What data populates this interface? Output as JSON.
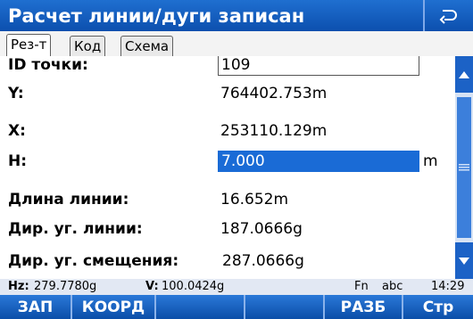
{
  "window": {
    "title": "Расчет линии/дуги записан"
  },
  "tabs": [
    {
      "label": "Рез-т",
      "active": true
    },
    {
      "label": "Код",
      "active": false
    },
    {
      "label": "Схема",
      "active": false
    }
  ],
  "fields": {
    "point_id": {
      "label": "ID точки:",
      "value": "109"
    },
    "y": {
      "label": "Y:",
      "value": "764402.753m"
    },
    "x": {
      "label": "X:",
      "value": "253110.129m"
    },
    "h": {
      "label": "H:",
      "value": "7.000",
      "unit": "m"
    },
    "line_length": {
      "label": "Длина линии:",
      "value": "16.652m"
    },
    "line_bearing": {
      "label": "Дир. уг. линии:",
      "value": "187.0666g"
    },
    "offset_bearing": {
      "label": "Дир. уг. смещения:",
      "value": "287.0666g"
    }
  },
  "status": {
    "hz_label": "Hz:",
    "hz_value": "279.7780g",
    "v_label": "V:",
    "v_value": "100.0424g",
    "fn": "Fn",
    "input_mode": "abc",
    "time": "14:29"
  },
  "softkeys": [
    "ЗАП",
    "КООРД",
    "",
    "",
    "РАЗБ",
    "Стр"
  ],
  "colors": {
    "titlebar": "#1059bd",
    "selection": "#1a6bd6",
    "softkeys": "#1a62c2"
  },
  "icons": {
    "back": "back-arrow-icon",
    "scroll_up": "triangle-up-icon",
    "scroll_down": "triangle-down-icon"
  }
}
